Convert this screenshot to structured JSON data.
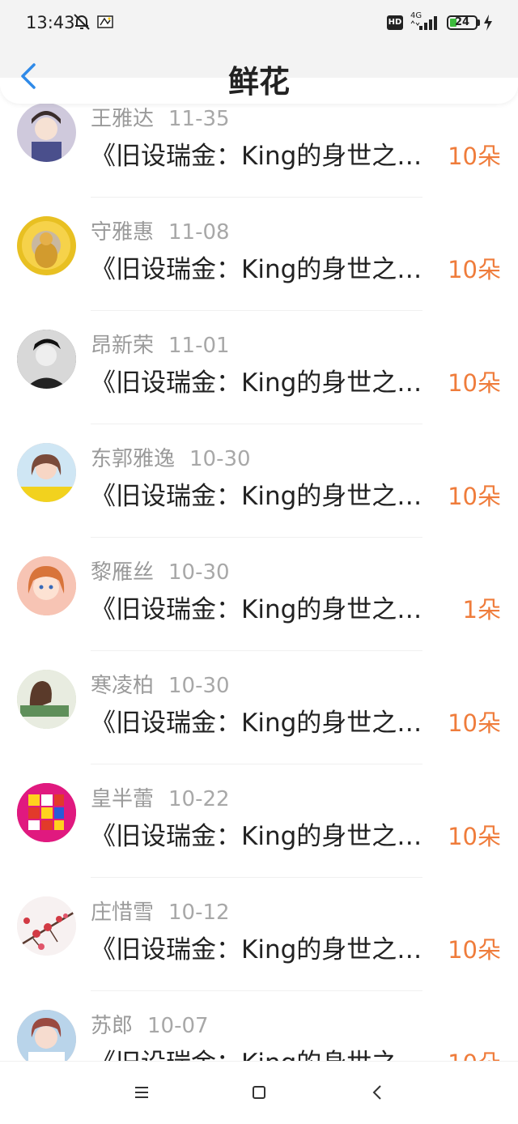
{
  "status_bar": {
    "time": "13:43",
    "network": "4G",
    "hd_label": "HD",
    "battery": "24"
  },
  "header": {
    "title": "鲜花"
  },
  "items": [
    {
      "name": "王雅达",
      "date": "11-35",
      "title": "《旧设瑞金：King的身世之谜》",
      "count": "10朵",
      "avatar_color": "#cfc9dc"
    },
    {
      "name": "守雅惠",
      "date": "11-08",
      "title": "《旧设瑞金：King的身世之谜》",
      "count": "10朵",
      "avatar_color": "#e8c022"
    },
    {
      "name": "昂新荣",
      "date": "11-01",
      "title": "《旧设瑞金：King的身世之谜》",
      "count": "10朵",
      "avatar_color": "#5a5a5a"
    },
    {
      "name": "东郭雅逸",
      "date": "10-30",
      "title": "《旧设瑞金：King的身世之谜》",
      "count": "10朵",
      "avatar_color": "#e9b9a6"
    },
    {
      "name": "黎雁丝",
      "date": "10-30",
      "title": "《旧设瑞金：King的身世之谜》",
      "count": "1朵",
      "avatar_color": "#f2a98b"
    },
    {
      "name": "寒凌柏",
      "date": "10-30",
      "title": "《旧设瑞金：King的身世之谜》",
      "count": "10朵",
      "avatar_color": "#c9d8b4"
    },
    {
      "name": "皇半蕾",
      "date": "10-22",
      "title": "《旧设瑞金：King的身世之谜》",
      "count": "10朵",
      "avatar_color": "#e0197f"
    },
    {
      "name": "庄惜雪",
      "date": "10-12",
      "title": "《旧设瑞金：King的身世之谜》",
      "count": "10朵",
      "avatar_color": "#f4eaea"
    },
    {
      "name": "苏郎",
      "date": "10-07",
      "title": "《旧设瑞金：King的身世之谜》",
      "count": "10朵",
      "avatar_color": "#d9b7b0"
    }
  ],
  "colors": {
    "accent_blue": "#2f8ae8",
    "flower_orange": "#ef7c3b"
  }
}
